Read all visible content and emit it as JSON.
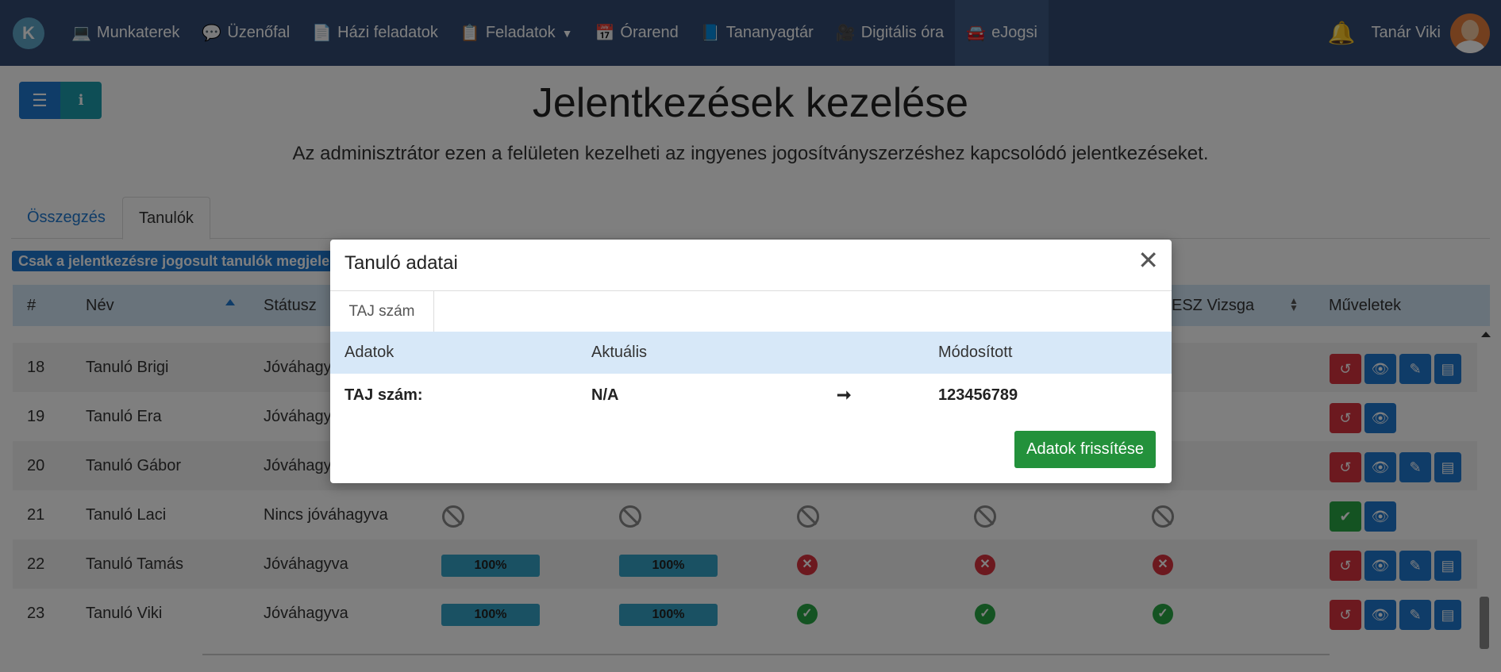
{
  "nav": {
    "brand_letter": "K",
    "items": [
      {
        "icon": "laptop-icon",
        "glyph": "💻",
        "label": "Munkaterek"
      },
      {
        "icon": "comment-icon",
        "glyph": "💬",
        "label": "Üzenőfal"
      },
      {
        "icon": "file-icon",
        "glyph": "📄",
        "label": "Házi feladatok"
      },
      {
        "icon": "clipboard-icon",
        "glyph": "📋",
        "label": "Feladatok"
      },
      {
        "icon": "calendar-icon",
        "glyph": "📅",
        "label": "Órarend"
      },
      {
        "icon": "book-icon",
        "glyph": "📘",
        "label": "Tananyagtár"
      },
      {
        "icon": "video-icon",
        "glyph": "🎥",
        "label": "Digitális óra"
      },
      {
        "icon": "car-icon",
        "glyph": "🚘",
        "label": "eJogsi"
      }
    ],
    "user_name": "Tanár Viki"
  },
  "page": {
    "title": "Jelentkezések kezelése",
    "description": "Az adminisztrátor ezen a felületen kezelheti az ingyenes jogosítványszerzéshez kapcsolódó jelentkezéseket."
  },
  "tabs": [
    "Összegzés",
    "Tanulók"
  ],
  "filter_badge": "Csak a jelentkezésre jogosult tanulók megjelen",
  "table": {
    "headers": {
      "num": "#",
      "name": "Név",
      "status": "Státusz",
      "exam": "ESZ Vizsga",
      "actions": "Műveletek"
    },
    "rows": [
      {
        "num": "18",
        "name": "Tanuló Brigi",
        "status": "Jóváhagy"
      },
      {
        "num": "19",
        "name": "Tanuló Era",
        "status": "Jóváhagy"
      },
      {
        "num": "20",
        "name": "Tanuló Gábor",
        "status": "Jóváhagy"
      },
      {
        "num": "21",
        "name": "Tanuló Laci",
        "status": "Nincs jóváhagyva"
      },
      {
        "num": "22",
        "name": "Tanuló Tamás",
        "status": "Jóváhagyva",
        "p1": "100%",
        "p2": "100%"
      },
      {
        "num": "23",
        "name": "Tanuló Viki",
        "status": "Jóváhagyva",
        "p1": "100%",
        "p2": "100%"
      }
    ]
  },
  "modal": {
    "title": "Tanuló adatai",
    "tab": "TAJ szám",
    "headers": {
      "data": "Adatok",
      "current": "Aktuális",
      "modified": "Módosított"
    },
    "row": {
      "label": "TAJ szám:",
      "current": "N/A",
      "arrow": "➞",
      "modified": "123456789"
    },
    "submit": "Adatok frissítése"
  },
  "colors": {
    "nav_bg": "#324b73",
    "primary": "#1f78d1",
    "success": "#28a745",
    "danger": "#d9333f"
  }
}
